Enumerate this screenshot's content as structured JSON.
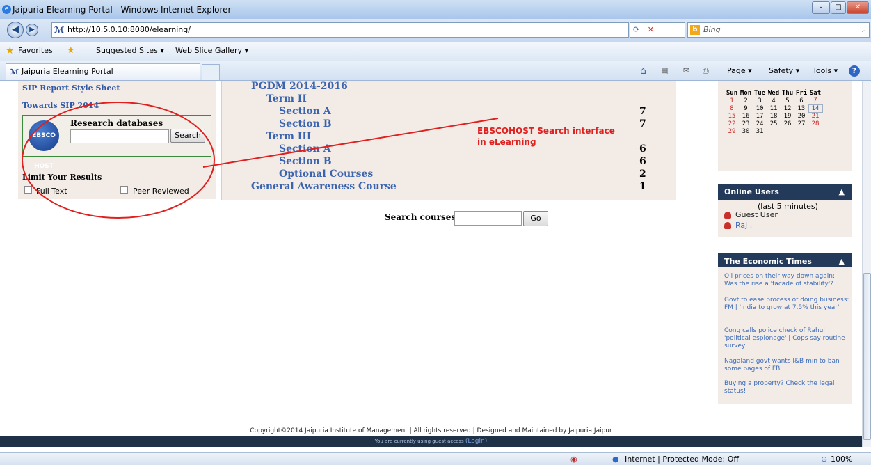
{
  "window": {
    "title": "Jaipuria Elearning Portal - Windows Internet Explorer",
    "min": "–",
    "max": "□",
    "close": "✕"
  },
  "address": {
    "url": "http://10.5.0.10:8080/elearning/",
    "search_engine": "Bing",
    "back": "◀",
    "fwd": "▶"
  },
  "favorites": {
    "label": "Favorites",
    "suggested": "Suggested Sites ▾",
    "webslice": "Web Slice Gallery ▾"
  },
  "tab": {
    "title": "Jaipuria Elearning Portal"
  },
  "commands": {
    "page": "Page ▾",
    "safety": "Safety ▾",
    "tools": "Tools ▾",
    "help": "?"
  },
  "left": {
    "links": [
      "SIP Report Style Sheet",
      "Towards SIP 2014"
    ],
    "ebsco": {
      "logo": "EBSCO HOST",
      "title": "Research databases",
      "search_button": "Search",
      "placeholder": ""
    },
    "limit_title": "Limit Your Results",
    "full_text": "Full Text",
    "peer_reviewed": "Peer Reviewed"
  },
  "courses": {
    "program": "PGDM 2014-2016",
    "items": [
      {
        "name": "Term II",
        "count": ""
      },
      {
        "name": "Section A",
        "count": "7"
      },
      {
        "name": "Section B",
        "count": "7"
      },
      {
        "name": "Term III",
        "count": ""
      },
      {
        "name": "Section A",
        "count": "6"
      },
      {
        "name": "Section B",
        "count": "6"
      },
      {
        "name": "Optional Courses",
        "count": "2"
      },
      {
        "name": "General Awareness Course",
        "count": "1"
      }
    ]
  },
  "search_courses": {
    "label": "Search courses:",
    "button": "Go"
  },
  "annotation": {
    "line1": "EBSCOHOST Search interface",
    "line2": "in eLearning",
    "color": "#e0201f"
  },
  "calendar": {
    "days": [
      "Sun",
      "Mon",
      "Tue",
      "Wed",
      "Thu",
      "Fri",
      "Sat"
    ],
    "weeks": [
      [
        "1",
        "2",
        "3",
        "4",
        "5",
        "6",
        "7"
      ],
      [
        "8",
        "9",
        "10",
        "11",
        "12",
        "13",
        "14"
      ],
      [
        "15",
        "16",
        "17",
        "18",
        "19",
        "20",
        "21"
      ],
      [
        "22",
        "23",
        "24",
        "25",
        "26",
        "27",
        "28"
      ],
      [
        "29",
        "30",
        "31",
        "",
        "",
        "",
        ""
      ]
    ],
    "today": "14"
  },
  "online": {
    "title": "Online Users",
    "arrow": "▲",
    "subtitle": "(last 5 minutes)",
    "users": [
      "Guest User",
      "Raj ."
    ]
  },
  "news": {
    "title": "The Economic Times",
    "arrow": "▲",
    "items": [
      "Oil prices on their way down again: Was the rise a 'facade of stability'?",
      "Govt to ease process of doing business: FM | 'India to grow at 7.5% this year'",
      "Cong calls police check of Rahul 'political espionage' | Cops say routine survey",
      "Nagaland govt wants I&B min to ban some pages of FB",
      "Buying a property? Check the legal status!"
    ]
  },
  "footer": {
    "copyright": "Copyright©2014 Jaipuria Institute of Management | All rights reserved | Designed and Maintained by Jaipuria Jaipur",
    "guest": "You are currently using guest access",
    "login": "(Login)"
  },
  "status": {
    "zone": "Internet | Protected Mode: Off",
    "zoom": "100%"
  },
  "colors": {
    "link": "#3a64b0",
    "panel": "#f3ece6",
    "block_header": "#243a5a",
    "annotation": "#e0201f"
  }
}
